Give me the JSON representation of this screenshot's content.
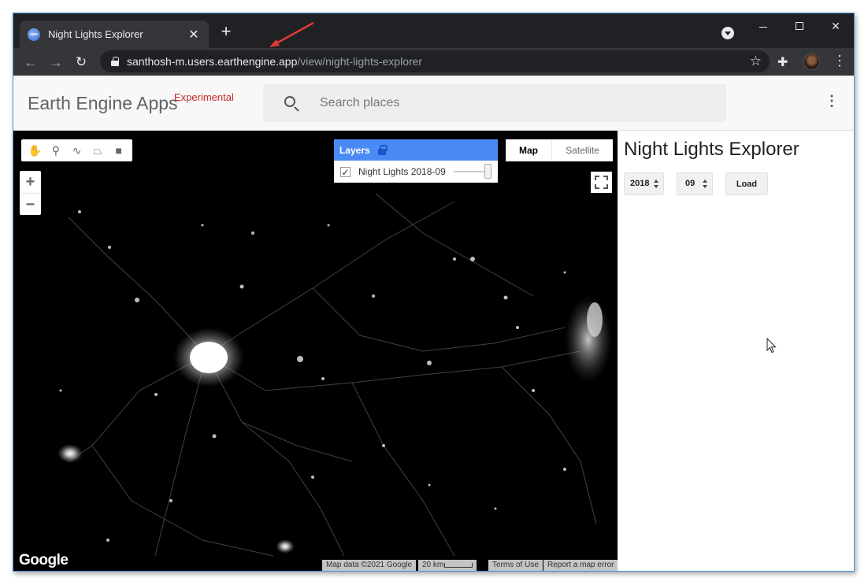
{
  "browser": {
    "tab_title": "Night Lights Explorer",
    "tab_close": "✕",
    "new_tab": "+",
    "url_host": "santhosh-m.users.earthengine.app",
    "url_path": "/view/night-lights-explorer",
    "icons": [
      "favicon-icon",
      "back-arrow-icon",
      "forward-arrow-icon",
      "reload-icon",
      "lock-icon",
      "star-icon",
      "extensions-icon",
      "profile-icon",
      "menu-icon"
    ]
  },
  "app": {
    "brand": "Earth Engine Apps",
    "badge": "Experimental",
    "search_placeholder": "Search places"
  },
  "map": {
    "zoom_in": "+",
    "zoom_out": "−",
    "layers_title": "Layers",
    "layer_name": "Night Lights 2018-09",
    "layer_checked": true,
    "layer_opacity": 1.0,
    "map_type_map": "Map",
    "map_type_satellite": "Satellite",
    "logo": "Google",
    "attribution": "Map data ©2021 Google",
    "scale_label": "20 km",
    "terms": "Terms of Use",
    "report": "Report a map error"
  },
  "panel": {
    "title": "Night Lights Explorer",
    "year": "2018",
    "month": "09",
    "load_label": "Load"
  },
  "colors": {
    "accent_layers": "#4a8af4",
    "badge_red": "#c62828",
    "annotation_arrow": "#e53935"
  }
}
